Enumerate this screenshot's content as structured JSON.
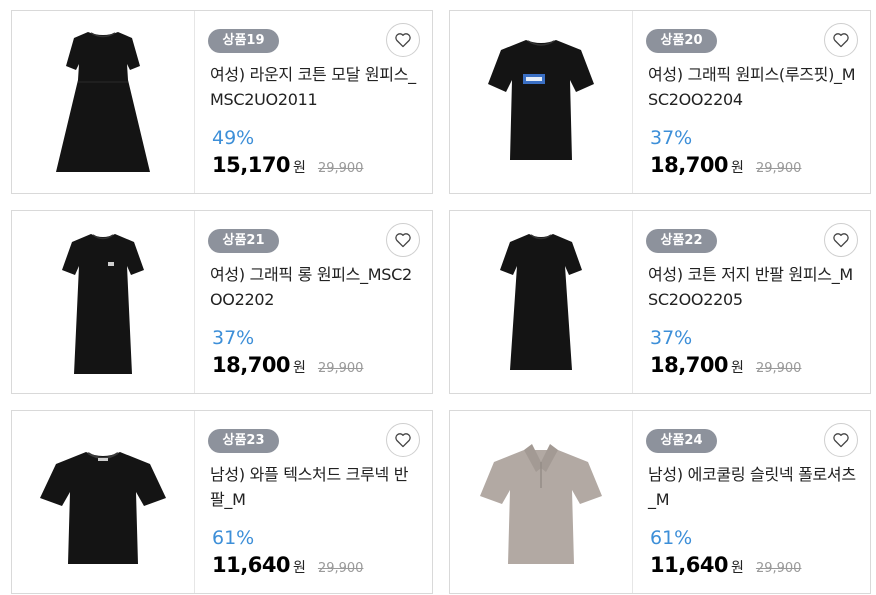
{
  "products": [
    {
      "badge": "상품19",
      "title": "여성) 라운지 코튼 모달 원피스_MSC2UO2011",
      "discount": "49%",
      "price": "15,170",
      "currency": "원",
      "original_price": "29,900",
      "image": "black-tiered-dress"
    },
    {
      "badge": "상품20",
      "title": "여성) 그래픽 원피스(루즈핏)_MSC2OO2204",
      "discount": "37%",
      "price": "18,700",
      "currency": "원",
      "original_price": "29,900",
      "image": "black-tshirt-dress-graphic"
    },
    {
      "badge": "상품21",
      "title": "여성) 그래픽 롱 원피스_MSC2OO2202",
      "discount": "37%",
      "price": "18,700",
      "currency": "원",
      "original_price": "29,900",
      "image": "black-long-dress"
    },
    {
      "badge": "상품22",
      "title": "여성) 코튼 저지 반팔 원피스_MSC2OO2205",
      "discount": "37%",
      "price": "18,700",
      "currency": "원",
      "original_price": "29,900",
      "image": "black-jersey-dress"
    },
    {
      "badge": "상품23",
      "title": "남성) 와플 텍스처드 크루넥 반팔_M",
      "discount": "61%",
      "price": "11,640",
      "currency": "원",
      "original_price": "29,900",
      "image": "black-crewneck-tee"
    },
    {
      "badge": "상품24",
      "title": "남성) 에코쿨링 슬릿넥 폴로셔츠_M",
      "discount": "61%",
      "price": "11,640",
      "currency": "원",
      "original_price": "29,900",
      "image": "grey-polo-shirt"
    }
  ],
  "colors": {
    "discount": "#3d8fd8",
    "badge": "#8d929c",
    "garment_black": "#141414",
    "garment_grey": "#b2a9a3"
  },
  "icons": {
    "wishlist": "heart-outline-icon"
  }
}
